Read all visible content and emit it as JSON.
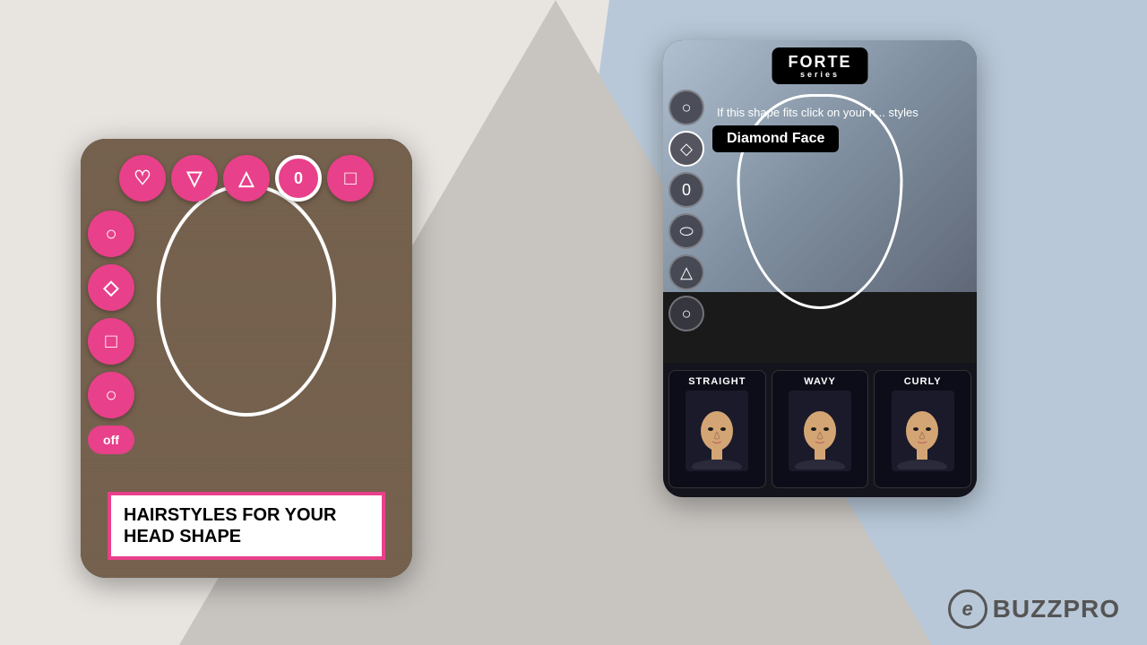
{
  "background": {
    "color_main": "#e8e4e0",
    "color_triangle": "#c8c4c0",
    "color_blue": "#b8c8d8"
  },
  "phone_left": {
    "title": "HAIRSTYLES FOR YOUR HEAD SHAPE",
    "buttons_top": [
      {
        "icon": "♡",
        "label": "heart",
        "active": false
      },
      {
        "icon": "▽",
        "label": "down-triangle",
        "active": false
      },
      {
        "icon": "△",
        "label": "up-triangle",
        "active": false
      },
      {
        "icon": "0",
        "label": "oval-active",
        "active": true
      },
      {
        "icon": "□",
        "label": "square",
        "active": false
      }
    ],
    "buttons_left": [
      {
        "icon": "○",
        "label": "circle"
      },
      {
        "icon": "◇",
        "label": "diamond"
      },
      {
        "icon": "□",
        "label": "square"
      },
      {
        "icon": "○",
        "label": "circle2"
      },
      {
        "icon": "OFF",
        "label": "off"
      }
    ],
    "banner_text": "HAIRSTYLES FOR\nYOUR HEAD SHAPE"
  },
  "phone_right": {
    "brand": "FORTE",
    "brand_sub": "series",
    "info_text": "If this shape fits click on your h... styles",
    "tooltip": "Diamond Face",
    "shape_buttons": [
      {
        "icon": "○",
        "label": "circle"
      },
      {
        "icon": "◇",
        "label": "diamond-active"
      },
      {
        "icon": "0",
        "label": "oval"
      },
      {
        "icon": "⬭",
        "label": "rounded-rect"
      },
      {
        "icon": "△",
        "label": "triangle"
      },
      {
        "icon": "○",
        "label": "circle2"
      }
    ],
    "hairstyles": [
      {
        "label": "STRAIGHT",
        "id": "straight"
      },
      {
        "label": "WAVY",
        "id": "wavy"
      },
      {
        "label": "CURLY",
        "id": "curly"
      }
    ]
  },
  "branding": {
    "logo_text": "BUZZPRO",
    "logo_icon": "e"
  }
}
